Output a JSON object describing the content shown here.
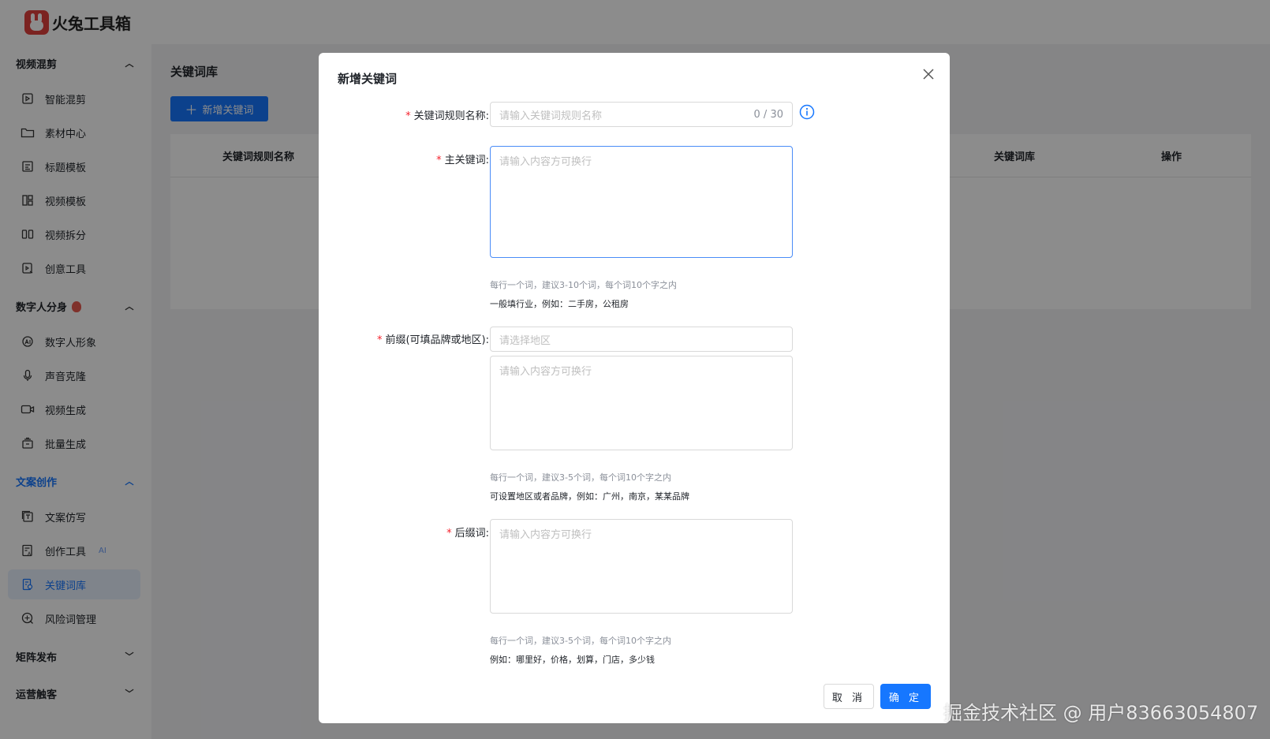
{
  "app": {
    "name": "火兔工具箱"
  },
  "sidebar": {
    "groups": [
      {
        "title": "视频混剪",
        "expanded": true,
        "items": [
          {
            "label": "智能混剪",
            "icon": "clip-icon"
          },
          {
            "label": "素材中心",
            "icon": "folder-icon"
          },
          {
            "label": "标题模板",
            "icon": "title-template-icon"
          },
          {
            "label": "视频模板",
            "icon": "layout-icon"
          },
          {
            "label": "视频拆分",
            "icon": "split-icon"
          },
          {
            "label": "创意工具",
            "icon": "creative-icon"
          }
        ]
      },
      {
        "title": "数字人分身",
        "expanded": true,
        "items": [
          {
            "label": "数字人形象",
            "icon": "avatar-icon"
          },
          {
            "label": "声音克隆",
            "icon": "microphone-icon"
          },
          {
            "label": "视频生成",
            "icon": "video-icon"
          },
          {
            "label": "批量生成",
            "icon": "batch-icon"
          }
        ]
      },
      {
        "title": "文案创作",
        "expanded": true,
        "items": [
          {
            "label": "文案仿写",
            "icon": "copywrite-icon"
          },
          {
            "label": "创作工具",
            "icon": "ai-write-icon",
            "badge": "AI"
          },
          {
            "label": "关键词库",
            "icon": "keyword-icon",
            "active": true
          },
          {
            "label": "风险词管理",
            "icon": "risk-icon"
          }
        ]
      },
      {
        "title": "矩阵发布",
        "expanded": false,
        "items": []
      },
      {
        "title": "运营触客",
        "expanded": false,
        "items": []
      }
    ]
  },
  "main": {
    "title": "关键词库",
    "add_button": "新增关键词",
    "columns": [
      "关键词规则名称",
      "关键词库",
      "操作"
    ]
  },
  "modal": {
    "title": "新增关键词",
    "fields": {
      "rule_name": {
        "label": "关键词规则名称:",
        "placeholder": "请输入关键词规则名称",
        "counter": "0 / 30"
      },
      "main_keyword": {
        "label": "主关键词:",
        "placeholder": "请输入内容方可换行",
        "hint1": "每行一个词，建议3-10个词，每个词10个字之内",
        "hint2": "一般填行业，例如：二手房，公租房"
      },
      "prefix": {
        "label": "前缀(可填品牌或地区):",
        "select_placeholder": "请选择地区",
        "placeholder": "请输入内容方可换行",
        "hint1": "每行一个词，建议3-5个词，每个词10个字之内",
        "hint2": "可设置地区或者品牌，例如：广州，南京，某某品牌"
      },
      "suffix": {
        "label": "后缀词:",
        "placeholder": "请输入内容方可换行",
        "hint1": "每行一个词，建议3-5个词，每个词10个字之内",
        "hint2": "例如：哪里好，价格，划算，门店，多少钱"
      }
    },
    "cancel": "取 消",
    "ok": "确 定"
  },
  "watermark": "掘金技术社区 @ 用户83663054807"
}
